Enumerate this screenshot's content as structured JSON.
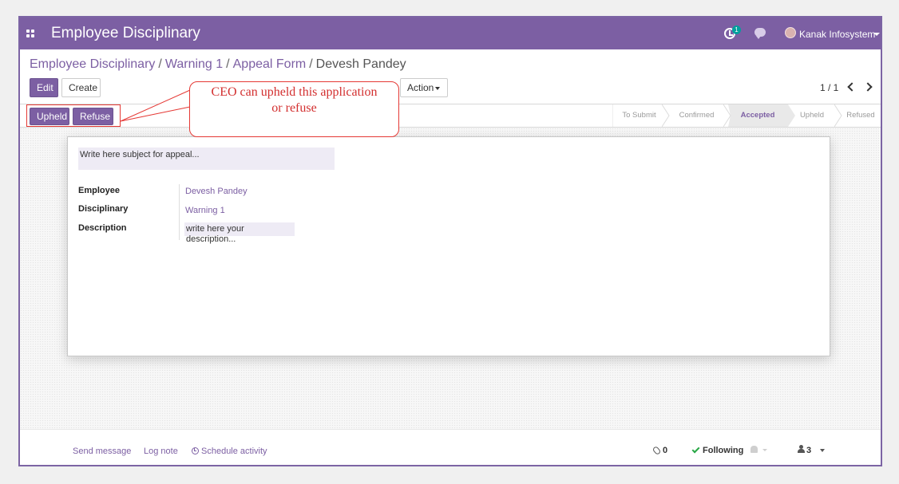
{
  "navbar": {
    "app_title": "Employee Disciplinary",
    "activity_badge": "1",
    "user_name": "Kanak Infosystem",
    "icons": [
      "apps-icon",
      "activity-icon",
      "chat-icon",
      "avatar"
    ]
  },
  "breadcrumb": {
    "items": [
      "Employee Disciplinary",
      "Warning 1",
      "Appeal Form"
    ],
    "separator": "/",
    "active": "Devesh Pandey"
  },
  "toolbar": {
    "edit_label": "Edit",
    "create_label": "Create",
    "action_label": "Action"
  },
  "pager": {
    "value": "1 / 1"
  },
  "status_bar": {
    "buttons": [
      "Upheld",
      "Refuse"
    ],
    "steps": [
      "To Submit",
      "Confirmed",
      "Accepted",
      "Upheld",
      "Refused"
    ],
    "active_step": "Accepted"
  },
  "callout": {
    "line1": "CEO can upheld this application",
    "line2": "or refuse"
  },
  "form": {
    "subject_placeholder": "Write here subject for appeal...",
    "fields": [
      {
        "label": "Employee",
        "value": "Devesh Pandey"
      },
      {
        "label": "Disciplinary",
        "value": "Warning 1"
      },
      {
        "label": "Description",
        "value": "write here your description..."
      }
    ]
  },
  "chatter": {
    "send_message": "Send message",
    "log_note": "Log note",
    "schedule_activity": "Schedule activity",
    "attachment_count": "0",
    "following_label": "Following",
    "followers_count": "3"
  },
  "colors": {
    "brand": "#7c5fa3",
    "annotation": "#e53935",
    "following_check": "#28a745"
  }
}
